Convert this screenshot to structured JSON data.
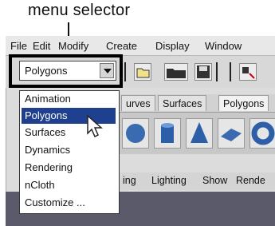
{
  "caption": "menu selector",
  "menubar": [
    "File",
    "Edit",
    "Modify",
    "Create",
    "Display",
    "Window"
  ],
  "selector": {
    "value": "Polygons"
  },
  "dropdown": [
    "Animation",
    "Polygons",
    "Surfaces",
    "Dynamics",
    "Rendering",
    "nCloth",
    "Customize ..."
  ],
  "dropdown_selected": "Polygons",
  "shelf_tabs": [
    "urves",
    "Surfaces",
    "Polygons"
  ],
  "panel_menu": [
    "ing",
    "Lighting",
    "Show",
    "Rende"
  ],
  "colors": {
    "highlight": "#1f3f8f",
    "outline": "#000000"
  },
  "icons": [
    "open-file-icon",
    "save-icon",
    "render-icon",
    "cylinder-icon",
    "cone-icon",
    "plane-icon",
    "torus-icon",
    "mouse-cursor-icon"
  ]
}
